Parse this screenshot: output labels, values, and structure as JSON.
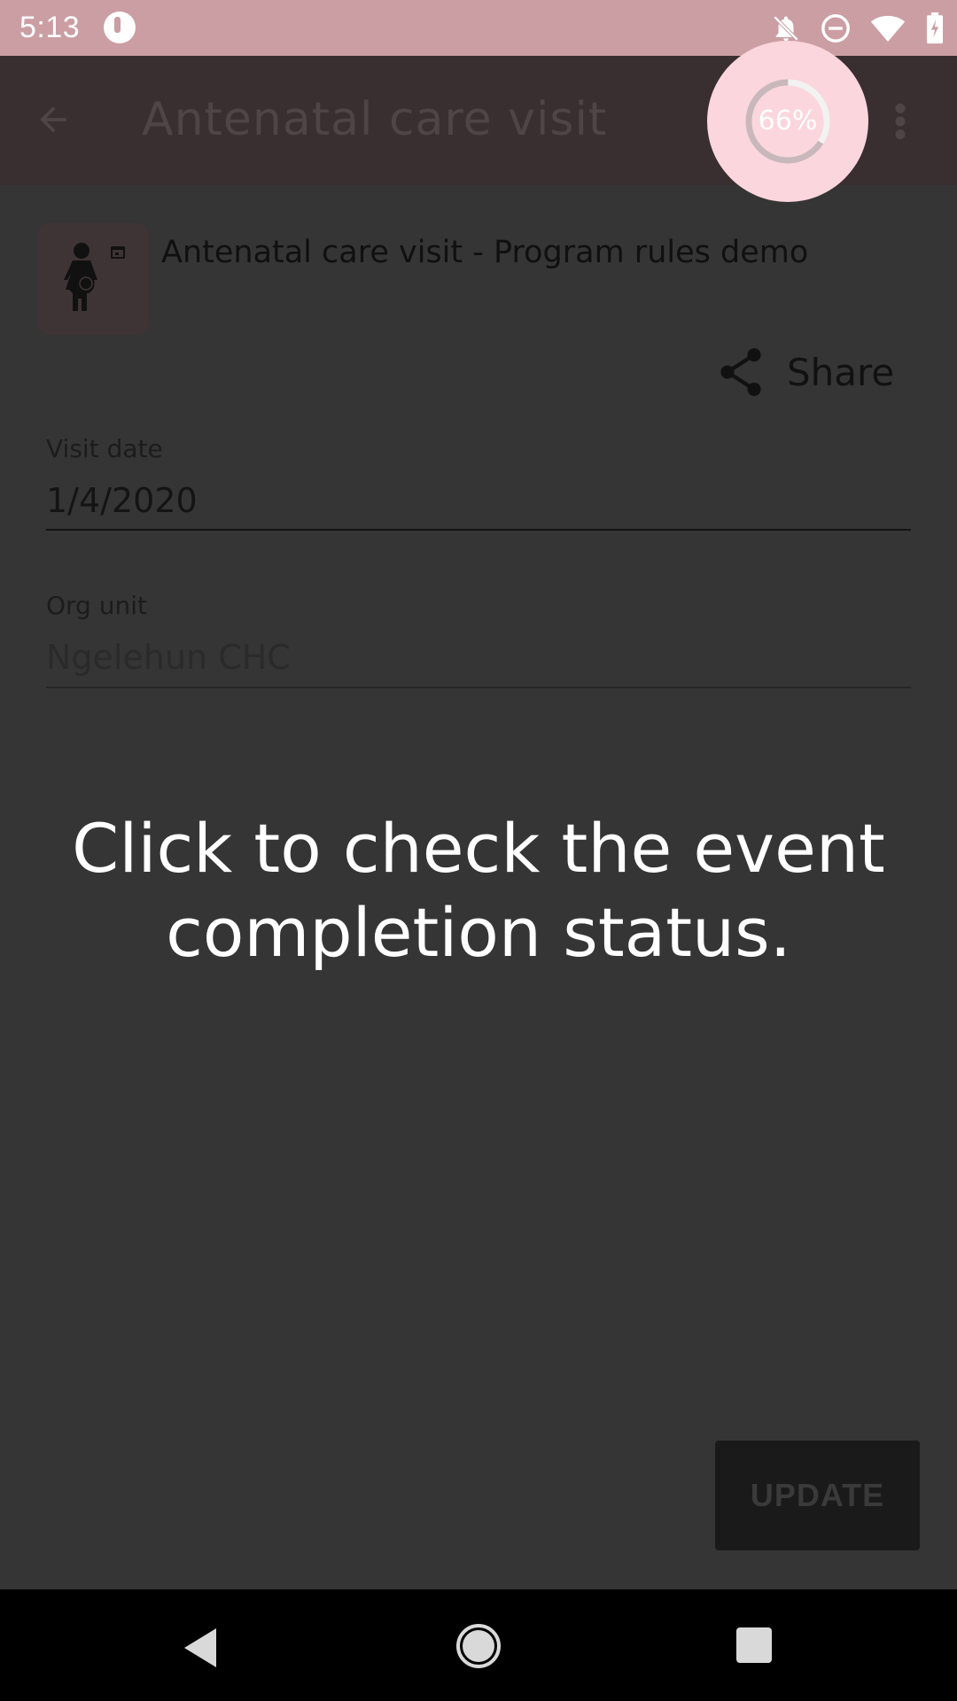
{
  "status_bar": {
    "time": "5:13",
    "icons": [
      "app-badge-icon",
      "notifications-off-icon",
      "do-not-disturb-icon",
      "wifi-icon",
      "battery-charging-icon"
    ]
  },
  "toolbar": {
    "title": "Antenatal care visit",
    "completion_percent": 66,
    "completion_text": "66%"
  },
  "header": {
    "program_title": "Antenatal care visit - Program rules demo",
    "share_label": "Share"
  },
  "form": {
    "visit_date_label": "Visit date",
    "visit_date_value": "1/4/2020",
    "org_unit_label": "Org unit",
    "org_unit_value": "Ngelehun CHC"
  },
  "coach_mark": {
    "message": "Click to check the event completion status."
  },
  "actions": {
    "update_label": "UPDATE"
  },
  "colors": {
    "status_bar": "#cb9ea4",
    "toolbar": "#3a2f30",
    "highlight": "#fbd6dc",
    "overlay_background": "#353535"
  }
}
